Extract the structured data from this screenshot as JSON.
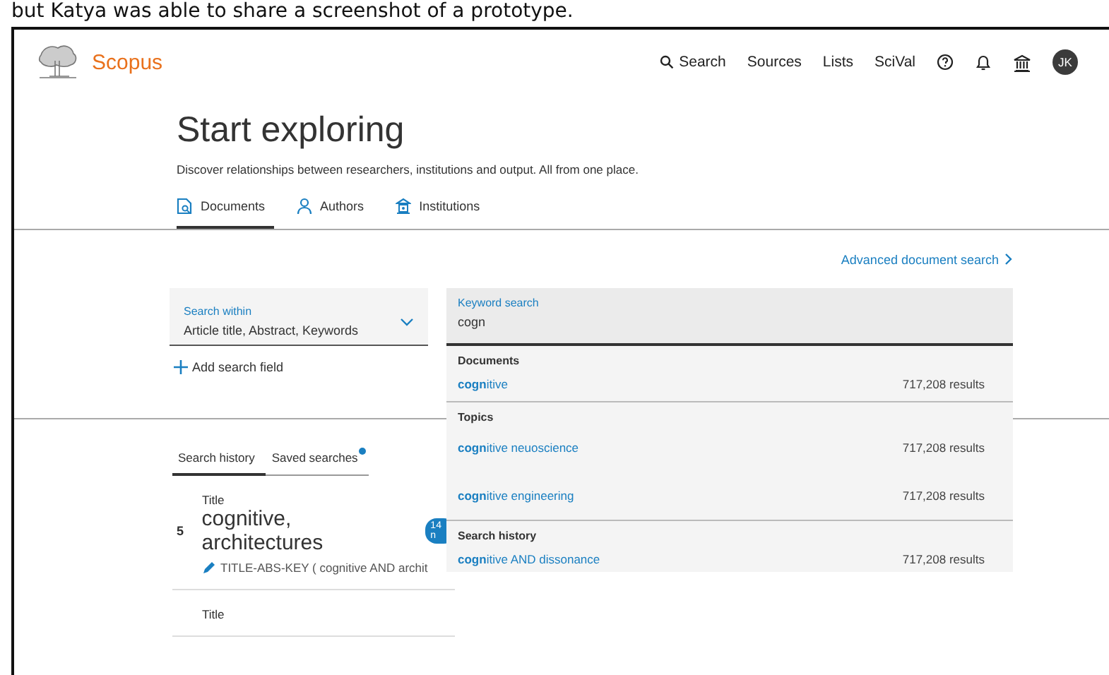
{
  "caption": "but Katya was able to share a screenshot of a prototype.",
  "header": {
    "logo_text": "Scopus",
    "nav": [
      {
        "label": "Search",
        "kind": "search"
      },
      {
        "label": "Sources",
        "kind": "text"
      },
      {
        "label": "Lists",
        "kind": "text"
      },
      {
        "label": "SciVal",
        "kind": "text"
      }
    ],
    "avatar_initials": "JK"
  },
  "hero": {
    "title": "Start exploring",
    "description": "Discover relationships between researchers, institutions and output. All from one place.",
    "tabs": [
      {
        "label": "Documents",
        "kind": "document",
        "selected": true
      },
      {
        "label": "Authors",
        "kind": "person",
        "selected": false
      },
      {
        "label": "Institutions",
        "kind": "institution",
        "selected": false
      }
    ]
  },
  "search": {
    "advanced_link": "Advanced document search",
    "within": {
      "label": "Search within",
      "value": "Article title, Abstract, Keywords"
    },
    "keyword": {
      "label": "Keyword search",
      "value": "cogn"
    },
    "add_field": "Add search field"
  },
  "dropdown": [
    {
      "heading": "Documents",
      "items": [
        {
          "text": "**cogn**itive",
          "count": "717,208 results"
        }
      ]
    },
    {
      "heading": "Topics",
      "items": [
        {
          "text": "**cogn**itive neuoscience",
          "count": "717,208 results"
        },
        {
          "text": "**cogn**itive engineering",
          "count": "717,208 results"
        }
      ]
    },
    {
      "heading": "Search history",
      "items": [
        {
          "text": "**cogn**itive AND dissonance",
          "count": "717,208 results"
        }
      ]
    }
  ],
  "history": {
    "tabs": [
      {
        "label": "Search history",
        "selected": true,
        "dot": false
      },
      {
        "label": "Saved searches",
        "selected": false,
        "dot": true
      }
    ],
    "items": [
      {
        "label": "Title",
        "number": "5",
        "title": "cognitive, architectures",
        "badge": "14 n",
        "query": "TITLE-ABS-KEY ( cognitive AND archit"
      },
      {
        "label": "Title"
      }
    ]
  }
}
